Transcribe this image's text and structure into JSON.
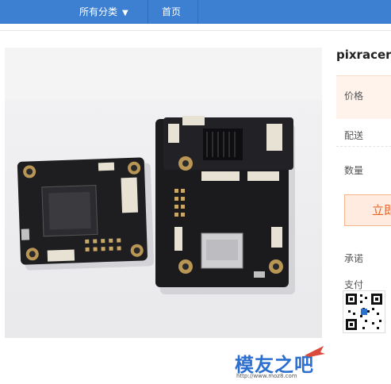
{
  "nav": {
    "categories_label": "所有分类",
    "home_label": "首页"
  },
  "product": {
    "title": "pixracer",
    "price_label": "价格",
    "shipping_label": "配送",
    "quantity_label": "数量",
    "buy_label": "立即",
    "promise_label": "承诺",
    "payment_label": "支付"
  },
  "watermark": {
    "brand": "模友之吧",
    "url": "http://www.moz8.com"
  },
  "colors": {
    "nav_bg": "#3d7fd1",
    "accent": "#e3652a",
    "price_bg": "#fff3ec"
  }
}
